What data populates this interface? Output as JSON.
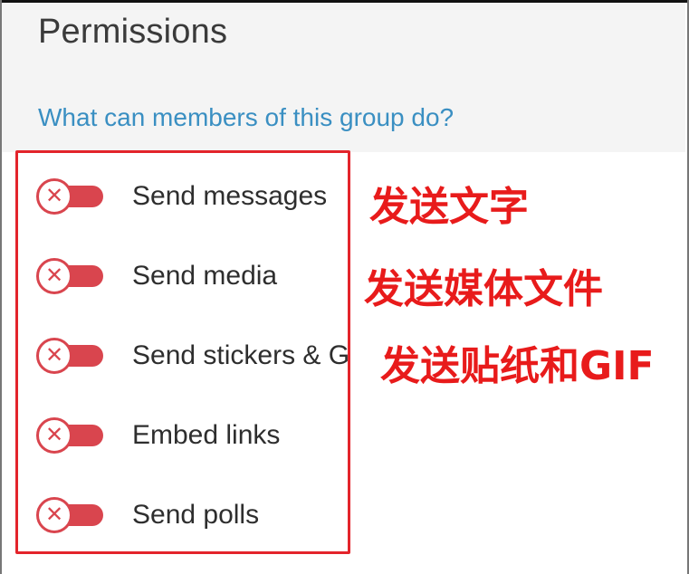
{
  "header": {
    "title": "Permissions",
    "subtitle": "What can members of this group do?"
  },
  "permissions": [
    {
      "label": "Send messages",
      "enabled": false,
      "icon": "x-icon"
    },
    {
      "label": "Send media",
      "enabled": false,
      "icon": "x-icon"
    },
    {
      "label": "Send stickers & GIFs",
      "enabled": false,
      "icon": "x-icon"
    },
    {
      "label": "Embed links",
      "enabled": false,
      "icon": "x-icon"
    },
    {
      "label": "Send polls",
      "enabled": false,
      "icon": "x-icon"
    }
  ],
  "annotations": [
    "发送文字",
    "发送媒体文件",
    "发送贴纸和GIF"
  ],
  "colors": {
    "toggle_off": "#d9454e",
    "subtitle": "#3a8fc2",
    "highlight_box": "#e3242b",
    "annotation_text": "#e81b1b"
  }
}
